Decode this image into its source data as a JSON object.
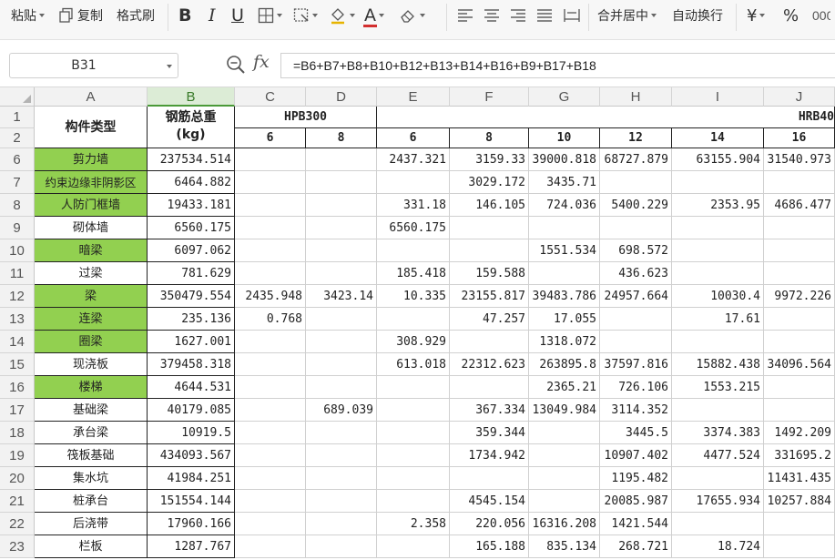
{
  "toolbar": {
    "paste_label": "粘贴",
    "copy_label": "复制",
    "format_painter_label": "格式刷",
    "bold_label": "B",
    "italic_label": "I",
    "underline_label": "U",
    "font_color_letter": "A",
    "merge_center_label": "合并居中",
    "wrap_text_label": "自动换行",
    "currency_label": "¥",
    "percent_label": "%",
    "accent_color": "#d32f2f"
  },
  "formula_bar": {
    "name_box": "B31",
    "fx_label": "fx",
    "formula": "=B6+B7+B8+B10+B12+B13+B14+B16+B9+B17+B18"
  },
  "sheet": {
    "columns": [
      "A",
      "B",
      "C",
      "D",
      "E",
      "F",
      "G",
      "H",
      "I",
      "J"
    ],
    "selected_column": "B",
    "header_row1": {
      "a": "构件类型",
      "b_line1": "钢筋总重",
      "b_line2": "(kg)",
      "group1": "HPB300",
      "group2": "HRB40"
    },
    "header_row2": [
      "6",
      "8",
      "6",
      "8",
      "10",
      "12",
      "14",
      "16"
    ],
    "green_color": "#92d050",
    "rows": [
      {
        "num": "6",
        "label": "剪力墙",
        "green": true,
        "values": [
          "237534.514",
          "",
          "",
          "2437.321",
          "3159.33",
          "39000.818",
          "68727.879",
          "63155.904",
          "31540.973"
        ]
      },
      {
        "num": "7",
        "label": "约束边缘非阴影区",
        "green": true,
        "values": [
          "6464.882",
          "",
          "",
          "",
          "3029.172",
          "3435.71",
          "",
          "",
          ""
        ]
      },
      {
        "num": "8",
        "label": "人防门框墙",
        "green": true,
        "values": [
          "19433.181",
          "",
          "",
          "331.18",
          "146.105",
          "724.036",
          "5400.229",
          "2353.95",
          "4686.477"
        ]
      },
      {
        "num": "9",
        "label": "砌体墙",
        "green": false,
        "values": [
          "6560.175",
          "",
          "",
          "6560.175",
          "",
          "",
          "",
          "",
          ""
        ]
      },
      {
        "num": "10",
        "label": "暗梁",
        "green": true,
        "values": [
          "6097.062",
          "",
          "",
          "",
          "",
          "1551.534",
          "698.572",
          "",
          ""
        ]
      },
      {
        "num": "11",
        "label": "过梁",
        "green": false,
        "values": [
          "781.629",
          "",
          "",
          "185.418",
          "159.588",
          "",
          "436.623",
          "",
          ""
        ]
      },
      {
        "num": "12",
        "label": "梁",
        "green": true,
        "values": [
          "350479.554",
          "2435.948",
          "3423.14",
          "10.335",
          "23155.817",
          "39483.786",
          "24957.664",
          "10030.4",
          "9972.226"
        ]
      },
      {
        "num": "13",
        "label": "连梁",
        "green": true,
        "values": [
          "235.136",
          "0.768",
          "",
          "",
          "47.257",
          "17.055",
          "",
          "17.61",
          ""
        ]
      },
      {
        "num": "14",
        "label": "圈梁",
        "green": true,
        "values": [
          "1627.001",
          "",
          "",
          "308.929",
          "",
          "1318.072",
          "",
          "",
          ""
        ]
      },
      {
        "num": "15",
        "label": "现浇板",
        "green": false,
        "values": [
          "379458.318",
          "",
          "",
          "613.018",
          "22312.623",
          "263895.8",
          "37597.816",
          "15882.438",
          "34096.564"
        ]
      },
      {
        "num": "16",
        "label": "楼梯",
        "green": true,
        "values": [
          "4644.531",
          "",
          "",
          "",
          "",
          "2365.21",
          "726.106",
          "1553.215",
          ""
        ]
      },
      {
        "num": "17",
        "label": "基础梁",
        "green": false,
        "values": [
          "40179.085",
          "",
          "689.039",
          "",
          "367.334",
          "13049.984",
          "3114.352",
          "",
          ""
        ]
      },
      {
        "num": "18",
        "label": "承台梁",
        "green": false,
        "values": [
          "10919.5",
          "",
          "",
          "",
          "359.344",
          "",
          "3445.5",
          "3374.383",
          "1492.209"
        ]
      },
      {
        "num": "19",
        "label": "筏板基础",
        "green": false,
        "values": [
          "434093.567",
          "",
          "",
          "",
          "1734.942",
          "",
          "10907.402",
          "4477.524",
          "331695.2"
        ]
      },
      {
        "num": "20",
        "label": "集水坑",
        "green": false,
        "values": [
          "41984.251",
          "",
          "",
          "",
          "",
          "",
          "1195.482",
          "",
          "11431.435"
        ]
      },
      {
        "num": "21",
        "label": "桩承台",
        "green": false,
        "values": [
          "151554.144",
          "",
          "",
          "",
          "4545.154",
          "",
          "20085.987",
          "17655.934",
          "10257.884"
        ]
      },
      {
        "num": "22",
        "label": "后浇带",
        "green": false,
        "values": [
          "17960.166",
          "",
          "",
          "2.358",
          "220.056",
          "16316.208",
          "1421.544",
          "",
          ""
        ]
      },
      {
        "num": "23",
        "label": "栏板",
        "green": false,
        "values": [
          "1287.767",
          "",
          "",
          "",
          "165.188",
          "835.134",
          "268.721",
          "18.724",
          ""
        ]
      }
    ]
  }
}
